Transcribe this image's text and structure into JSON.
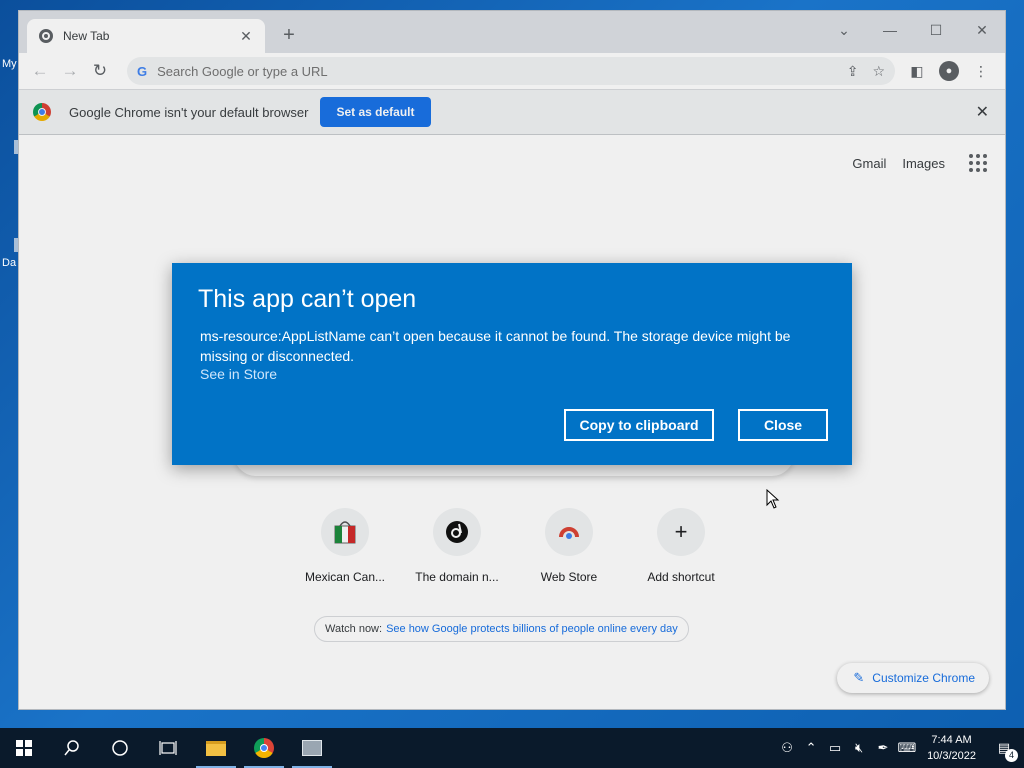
{
  "desktop": {
    "label_top": "My",
    "label_bottom": "Da"
  },
  "browser": {
    "tab_title": "New Tab",
    "omnibox_placeholder": "Search Google or type a URL",
    "infobar": {
      "message": "Google Chrome isn't your default browser",
      "button": "Set as default"
    },
    "ntp": {
      "links": [
        "Gmail",
        "Images"
      ],
      "shortcuts": [
        {
          "label": "Mexican Can..."
        },
        {
          "label": "The domain n..."
        },
        {
          "label": "Web Store"
        },
        {
          "label": "Add shortcut",
          "icon": "+"
        }
      ],
      "watch_prefix": "Watch now:",
      "watch_link": "See how Google protects billions of people online every day",
      "customize": "Customize Chrome"
    }
  },
  "dialog": {
    "title": "This app can’t open",
    "message": "ms-resource:AppListName can’t open because it cannot be found. The storage device might be missing or disconnected.",
    "store_link": "See in Store",
    "copy_button": "Copy to clipboard",
    "close_button": "Close"
  },
  "taskbar": {
    "time": "7:44 AM",
    "date": "10/3/2022",
    "notification_count": "4"
  },
  "colors": {
    "dialog_bg": "#0173c6",
    "accent": "#1a73e8",
    "taskbar": "#0a1a2b"
  }
}
